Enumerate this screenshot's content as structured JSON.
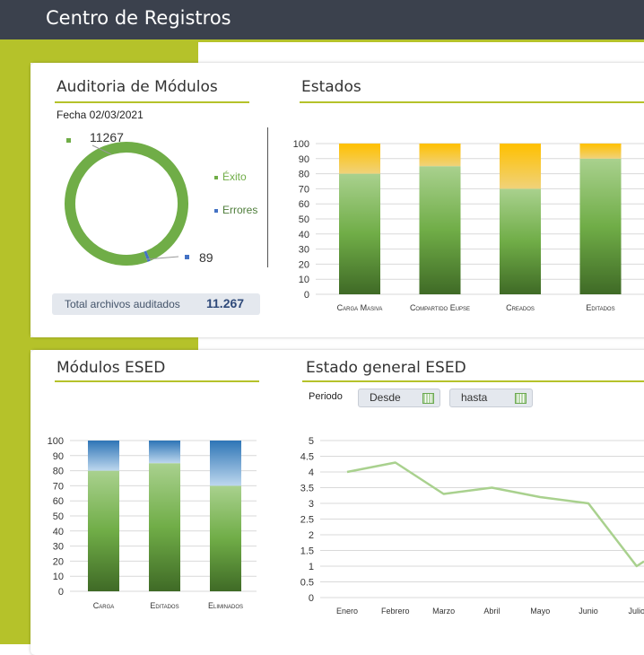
{
  "header": {
    "title": "Centro de Registros"
  },
  "auditoria": {
    "title": "Auditoria de Módulos",
    "fecha": "Fecha 02/03/2021",
    "value_exito": "11267",
    "value_errores": "89",
    "legend": [
      {
        "label": "Éxito",
        "color": "#70ad47"
      },
      {
        "label": "Errores",
        "color": "#4472c4"
      }
    ],
    "total_label": "Total archivos auditados",
    "total_value": "11.267"
  },
  "estados": {
    "title": "Estados"
  },
  "modulos": {
    "title": "Módulos ESED"
  },
  "estado_general": {
    "title": "Estado general ESED",
    "periodo_label": "Periodo",
    "desde": "Desde",
    "hasta": "hasta"
  },
  "chart_data": [
    {
      "id": "auditoria_donut",
      "type": "pie",
      "categories": [
        "Éxito",
        "Errores"
      ],
      "values": [
        11267,
        89
      ],
      "colors": [
        "#70ad47",
        "#4472c4"
      ]
    },
    {
      "id": "estados_bar",
      "type": "bar",
      "stacked": true,
      "categories": [
        "Carga Masiva",
        "Compartido Eupse",
        "Creados",
        "Editados"
      ],
      "series": [
        {
          "values": [
            80,
            85,
            70,
            90
          ],
          "color": "#70ad47"
        },
        {
          "values": [
            20,
            15,
            30,
            10
          ],
          "color": "#ffc000"
        }
      ],
      "ylim": [
        0,
        100
      ],
      "yticks": [
        0,
        10,
        20,
        30,
        40,
        50,
        60,
        70,
        80,
        90,
        100
      ],
      "grid": true
    },
    {
      "id": "modulos_bar",
      "type": "bar",
      "stacked": true,
      "categories": [
        "Carga",
        "Editados",
        "Eliminados"
      ],
      "series": [
        {
          "values": [
            80,
            85,
            70
          ],
          "color": "#70ad47"
        },
        {
          "values": [
            20,
            15,
            30
          ],
          "color": "#5b9bd5"
        }
      ],
      "ylim": [
        0,
        100
      ],
      "yticks": [
        0,
        10,
        20,
        30,
        40,
        50,
        60,
        70,
        80,
        90,
        100
      ],
      "grid": true
    },
    {
      "id": "estado_general_line",
      "type": "line",
      "x": [
        "Enero",
        "Febrero",
        "Marzo",
        "Abril",
        "Mayo",
        "Junio",
        "Julio"
      ],
      "y": [
        4.0,
        4.3,
        3.3,
        3.5,
        3.2,
        3.0,
        1.0
      ],
      "y_next": 2.0,
      "color": "#a9d18e",
      "ylim": [
        0,
        5
      ],
      "yticks": [
        "0",
        "0.5",
        "1",
        "1.5",
        "2",
        "2.5",
        "3",
        "3.5",
        "4",
        "4.5",
        "5"
      ],
      "grid": true
    }
  ]
}
